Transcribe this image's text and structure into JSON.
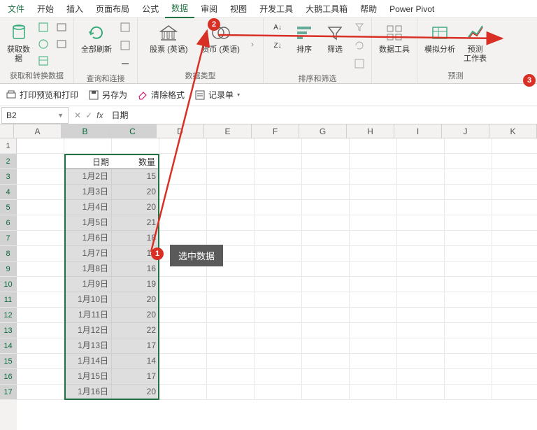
{
  "menubar": {
    "items": [
      "文件",
      "开始",
      "插入",
      "页面布局",
      "公式",
      "数据",
      "审阅",
      "视图",
      "开发工具",
      "大鹅工具箱",
      "帮助",
      "Power Pivot"
    ],
    "active_index": 5
  },
  "ribbon": {
    "groups": [
      {
        "label": "获取和转换数据",
        "buttons": [
          {
            "name": "get-data",
            "label": "获取数\n据"
          }
        ]
      },
      {
        "label": "查询和连接",
        "buttons": [
          {
            "name": "refresh-all",
            "label": "全部刷新"
          }
        ]
      },
      {
        "label": "数据类型",
        "buttons": [
          {
            "name": "stocks",
            "label": "股票 (英语)"
          },
          {
            "name": "currency",
            "label": "货币 (英语)"
          }
        ]
      },
      {
        "label": "排序和筛选",
        "buttons": [
          {
            "name": "sort",
            "label": "排序"
          },
          {
            "name": "filter",
            "label": "筛选"
          }
        ]
      },
      {
        "label": "",
        "buttons": [
          {
            "name": "data-tools",
            "label": "数据工具"
          }
        ]
      },
      {
        "label": "预测",
        "buttons": [
          {
            "name": "whatif",
            "label": "模拟分析"
          },
          {
            "name": "forecast",
            "label": "预测\n工作表"
          }
        ]
      }
    ]
  },
  "qat": {
    "items": [
      {
        "name": "print-preview",
        "label": "打印预览和打印"
      },
      {
        "name": "save-as",
        "label": "另存为"
      },
      {
        "name": "clear-format",
        "label": "清除格式"
      },
      {
        "name": "record-form",
        "label": "记录单"
      }
    ]
  },
  "namebox": "B2",
  "formula": "日期",
  "columns": [
    "A",
    "B",
    "C",
    "D",
    "E",
    "F",
    "G",
    "H",
    "I",
    "J",
    "K"
  ],
  "selected_cols": [
    1,
    2
  ],
  "row_count": 17,
  "selected_rows_from": 2,
  "table": {
    "headers": [
      "日期",
      "数量"
    ],
    "rows": [
      [
        "1月2日",
        "15"
      ],
      [
        "1月3日",
        "20"
      ],
      [
        "1月4日",
        "20"
      ],
      [
        "1月5日",
        "21"
      ],
      [
        "1月6日",
        "18"
      ],
      [
        "1月7日",
        "15"
      ],
      [
        "1月8日",
        "16"
      ],
      [
        "1月9日",
        "19"
      ],
      [
        "1月10日",
        "20"
      ],
      [
        "1月11日",
        "20"
      ],
      [
        "1月12日",
        "22"
      ],
      [
        "1月13日",
        "17"
      ],
      [
        "1月14日",
        "14"
      ],
      [
        "1月15日",
        "17"
      ],
      [
        "1月16日",
        "20"
      ]
    ]
  },
  "annotations": {
    "badge1": "1",
    "badge2": "2",
    "badge3": "3",
    "tip": "选中数据"
  }
}
